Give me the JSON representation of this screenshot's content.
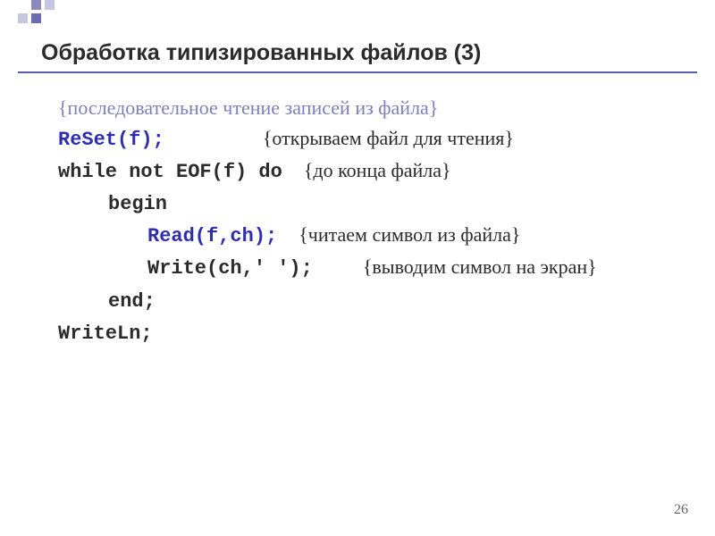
{
  "slide": {
    "title": "Обработка типизированных файлов (3)",
    "page_number": "26"
  },
  "lines": {
    "l1_comment": "{последовательное чтение записей из файла}",
    "l2_code": "ReSet(f);",
    "l2_comment": "{открываем файл для чтения}",
    "l3_code": "while not EOF(f) do",
    "l3_comment": "{до конца файла}",
    "l4_code": "begin",
    "l5_code": "Read(f,ch);",
    "l5_comment": "{читаем символ из файла}",
    "l6_code": "Write(ch,' ');",
    "l6_comment": "{выводим символ на экран}",
    "l7_code": "end;",
    "l8_code": "WriteLn;"
  }
}
